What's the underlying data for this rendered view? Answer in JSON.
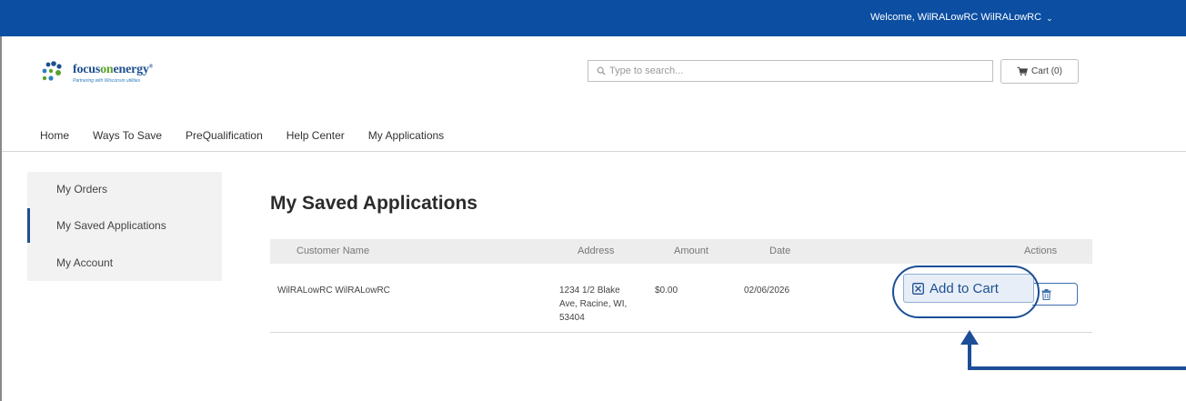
{
  "header": {
    "welcome_text": "Welcome,  WilRALowRC WilRALowRC",
    "brand_color": "#0b4ea2"
  },
  "logo": {
    "name_part1": "focus",
    "name_part2": "on",
    "name_part3": "energy",
    "tagline": "Partnering with Wisconsin utilities"
  },
  "search": {
    "placeholder": "Type to search..."
  },
  "cart": {
    "label": "Cart (0)"
  },
  "nav": {
    "items": [
      "Home",
      "Ways To Save",
      "PreQualification",
      "Help Center",
      "My Applications"
    ]
  },
  "sidebar": {
    "items": [
      "My Orders",
      "My Saved Applications",
      "My Account"
    ],
    "active_index": 1
  },
  "page": {
    "title": "My Saved Applications"
  },
  "table": {
    "headers": {
      "customer_name": "Customer Name",
      "address": "Address",
      "amount": "Amount",
      "date": "Date",
      "actions": "Actions"
    },
    "rows": [
      {
        "customer_name": "WilRALowRC WilRALowRC",
        "address_line1": "1234 1/2 Blake",
        "address_line2": "Ave, Racine, WI,",
        "address_line3": "53404",
        "amount": "$0.00",
        "date": "02/06/2026",
        "add_to_cart_label": "Add to Cart"
      }
    ]
  },
  "icons": {
    "search": "search-icon",
    "cart": "cart-icon",
    "add_to_cart": "add-to-cart-icon",
    "delete": "trash-icon",
    "chevron": "chevron-down-icon"
  }
}
